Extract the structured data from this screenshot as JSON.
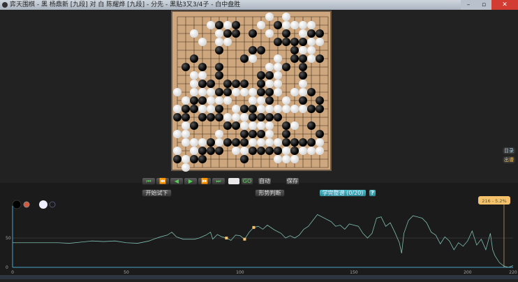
{
  "window": {
    "title": "弈天围棋 - 黑 杨鼎新 [九段] 对 白 陈耀烨 [九段] - 分先 - 黑贴3又3/4子 - 白中盘胜",
    "minimize": "–",
    "maximize": "▫",
    "close": "✕"
  },
  "board": {
    "size": 19,
    "rows": [
      "...........W.W.....",
      "....WBWB..W.BWWWW..",
      "..W..WBB.B.W.B.WBB.",
      "...W.WW.....BBBBWW.",
      ".....B...BB...BWW..",
      "..B.....BW..W.BBWB.",
      ".B.B.B.....WWB.B...",
      "..WW.B....BBW..B...",
      "..WBB.BBB.BWW..W...",
      "W.WWWBBWWWBBW.WWB..",
      ".WBBWWW..WWB.W.B.B.",
      "WBBWWB.WBBWWWWWWBB.",
      "BB.BBBWWWBBBB......",
      ".WB...BBWWWW.BW.B..",
      "WW...W..BBBW.B...B.",
      ".WWWBWBBBWWWWBBBBW.",
      "W.WBBB.WWBBBBWBWWW.",
      "BWBB....B...WWW....",
      ".W................."
    ]
  },
  "controls": {
    "first": "⏮",
    "prev10": "⏪",
    "prev": "◀",
    "next": "▶",
    "next10": "⏩",
    "last": "⏭",
    "move_input": "",
    "go": "GO",
    "auto": "自动",
    "save": "保存",
    "try": "开始试下",
    "judge": "形势判断",
    "learn": "学完整谱 (0/20)",
    "help": "?"
  },
  "side_buttons": [
    "目录",
    "出谱"
  ],
  "colors": {
    "black_line": "#7fbfb0",
    "axis": "#4aa3c8",
    "marker": "#f5c26b",
    "tooltip": "#f5c26b"
  },
  "chart_data": {
    "type": "line",
    "xlim": [
      0,
      220
    ],
    "ylim": [
      0,
      100
    ],
    "xticks": [
      "0",
      "50",
      "100",
      "150",
      "200",
      "220"
    ],
    "yticks": [
      "0",
      "50"
    ],
    "grid": "horizontal line at 50",
    "x": [
      0,
      10,
      20,
      25,
      30,
      35,
      40,
      45,
      50,
      55,
      60,
      62,
      65,
      68,
      70,
      72,
      75,
      80,
      82,
      85,
      87,
      88,
      90,
      92,
      94,
      96,
      98,
      100,
      102,
      104,
      106,
      108,
      110,
      112,
      115,
      118,
      120,
      122,
      124,
      126,
      128,
      130,
      132,
      134,
      136,
      138,
      140,
      142,
      144,
      146,
      148,
      150,
      152,
      154,
      156,
      158,
      160,
      162,
      164,
      166,
      168,
      170,
      171,
      172,
      174,
      176,
      178,
      180,
      182,
      184,
      186,
      188,
      190,
      192,
      194,
      196,
      198,
      200,
      202,
      204,
      206,
      208,
      210,
      211,
      212,
      214,
      216,
      218,
      220
    ],
    "y": [
      42,
      42,
      42,
      41,
      43,
      45,
      44,
      45,
      42,
      41,
      45,
      48,
      52,
      55,
      60,
      52,
      48,
      48,
      50,
      55,
      60,
      48,
      56,
      52,
      50,
      46,
      55,
      54,
      48,
      60,
      68,
      70,
      65,
      72,
      64,
      58,
      50,
      54,
      50,
      55,
      65,
      70,
      80,
      90,
      86,
      82,
      78,
      70,
      72,
      65,
      74,
      72,
      70,
      58,
      50,
      58,
      84,
      86,
      70,
      76,
      60,
      42,
      24,
      58,
      80,
      88,
      86,
      84,
      76,
      60,
      55,
      40,
      52,
      45,
      30,
      42,
      36,
      45,
      62,
      38,
      48,
      30,
      58,
      30,
      20,
      8,
      2,
      0,
      3
    ],
    "markers": [
      {
        "x": 94,
        "y": 50
      },
      {
        "x": 102,
        "y": 48
      },
      {
        "x": 106,
        "y": 68
      }
    ],
    "current": {
      "move": 216,
      "label": "216 - 5.2%"
    }
  }
}
